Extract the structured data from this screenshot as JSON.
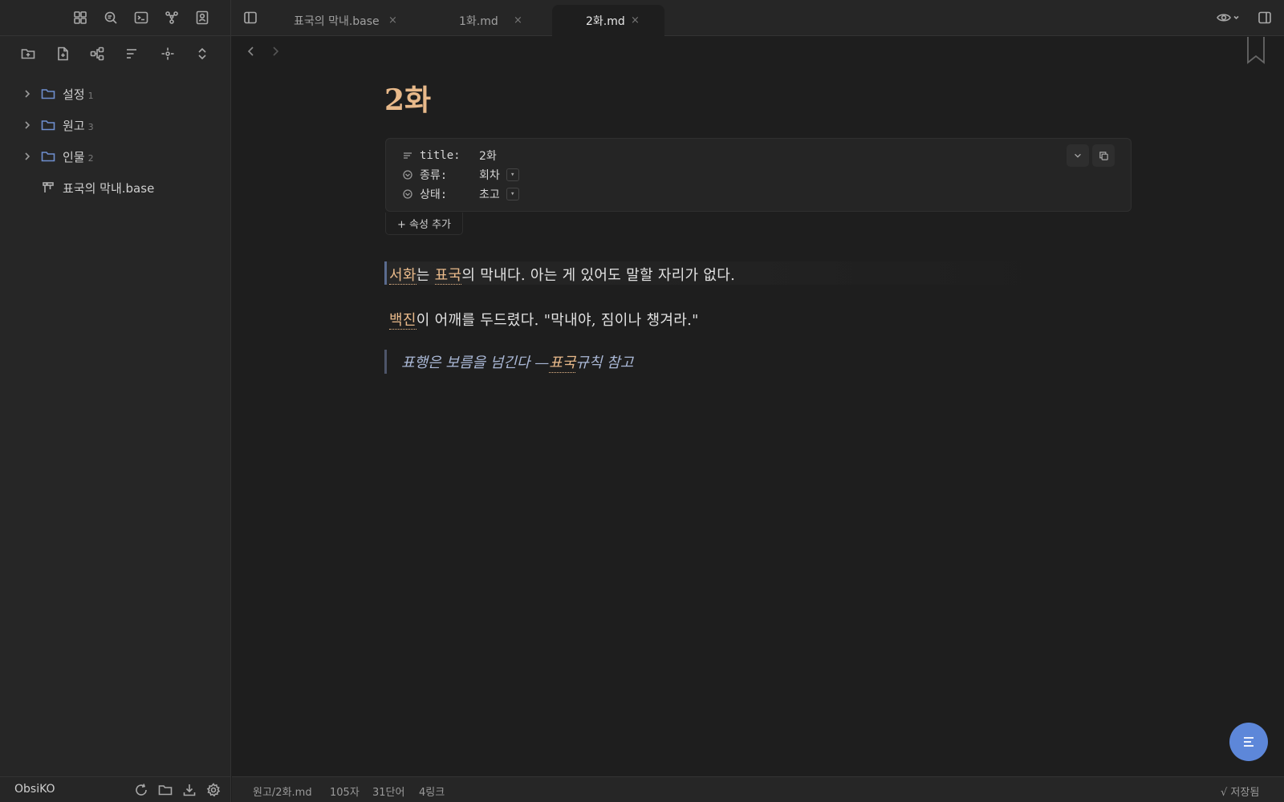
{
  "sidebar": {
    "top_icons": [
      "dashboard-icon",
      "search-icon",
      "terminal-icon",
      "graph-icon",
      "contacts-icon"
    ],
    "action_icons": [
      "new-folder-icon",
      "new-note-icon",
      "canvas-icon",
      "sort-icon",
      "locate-icon",
      "collapse-icon"
    ],
    "tree": [
      {
        "label": "설정",
        "count": "1",
        "type": "folder"
      },
      {
        "label": "원고",
        "count": "3",
        "type": "folder"
      },
      {
        "label": "인물",
        "count": "2",
        "type": "folder"
      },
      {
        "label": "표국의 막내.base",
        "count": "",
        "type": "base"
      }
    ],
    "vault_name": "ObsiKO"
  },
  "tabs": [
    {
      "label": "표국의 막내.base",
      "close": "×",
      "active": false
    },
    {
      "label": "1화.md",
      "close": "×",
      "active": false
    },
    {
      "label": "2화.md",
      "close": "×",
      "active": true
    }
  ],
  "editor": {
    "title": "2화",
    "properties": [
      {
        "key": "title:",
        "value": "2화",
        "icon": "text-icon",
        "dropdown": false
      },
      {
        "key": "종류:",
        "value": "회차",
        "icon": "select-icon",
        "dropdown": true
      },
      {
        "key": "상태:",
        "value": "초고",
        "icon": "select-icon",
        "dropdown": true
      }
    ],
    "add_property": "+ 속성 추가",
    "para1": {
      "link1": "서화",
      "t1": "는 ",
      "link2": "표국",
      "t2": "의 막내다. 아는 게 있어도 말할 자리가 없다."
    },
    "para2": {
      "link1": "백진",
      "t1": "이 어깨를 두드렸다. \"막내야, 짐이나 챙겨라.\""
    },
    "quote": {
      "t1": "표행은 보름을 넘긴다 — ",
      "link": "표국",
      "t2": " 규칙 참고"
    }
  },
  "status": {
    "path": "원고/2화.md",
    "chars": "105자",
    "words": "31단어",
    "links": "4링크",
    "saved": "√ 저장됨"
  },
  "colors": {
    "accent": "#e8b98a",
    "folder": "#6f8fcf",
    "fab": "#5d87d9",
    "quote": "#aab8d6"
  }
}
